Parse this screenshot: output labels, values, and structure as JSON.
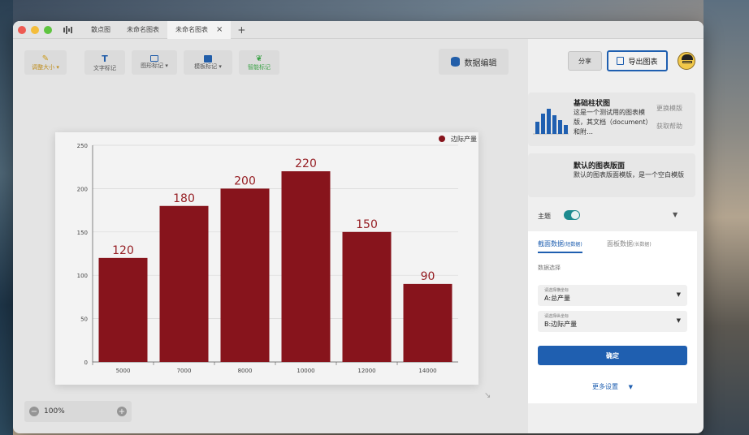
{
  "window": {
    "tabs": [
      {
        "label": "散点图"
      },
      {
        "label": "未命名图表"
      },
      {
        "label": "未命名图表",
        "active": true
      }
    ],
    "add_tab": "+",
    "close_tab": "×"
  },
  "toolbar": {
    "brush_size": "调整大小",
    "text_mark": "文字标记",
    "shape_mark": "图形标记",
    "template_mark": "模板标记",
    "smart_mark": "智能标记",
    "data_edit": "数据编辑",
    "share": "分享",
    "export": "导出图表"
  },
  "template": {
    "title": "基础柱状图",
    "desc": "这是一个测试用的图表模版，其文档（document）和附…",
    "change": "更换模版",
    "help": "获取帮助"
  },
  "panel_template": {
    "title": "默认的图表版面",
    "desc": "默认的图表版面模版，是一个空白模版"
  },
  "theme": {
    "label": "主题"
  },
  "data_panel": {
    "tab1": "截面数据",
    "tab1_sub": "(短数据)",
    "tab2": "面板数据",
    "tab2_sub": "(长数据)",
    "section": "数据选择",
    "x_hint": "请选择横坐标",
    "x_value": "A:总产量",
    "y_hint": "请选择纵坐标",
    "y_value": "B:边际产量",
    "confirm": "确定",
    "more": "更多设置"
  },
  "zoom": {
    "value": "100%"
  },
  "colors": {
    "bar": "#8b1018",
    "accent": "#1f5fb0"
  },
  "chart_data": {
    "type": "bar",
    "categories": [
      "5000",
      "7000",
      "8000",
      "10000",
      "12000",
      "14000"
    ],
    "series": [
      {
        "name": "边际产量",
        "values": [
          120,
          180,
          200,
          220,
          150,
          90
        ]
      }
    ],
    "yticks": [
      "0",
      "50",
      "100",
      "150",
      "200",
      "250"
    ],
    "ylim": [
      0,
      250
    ],
    "legend": "top-right",
    "grid": true
  }
}
